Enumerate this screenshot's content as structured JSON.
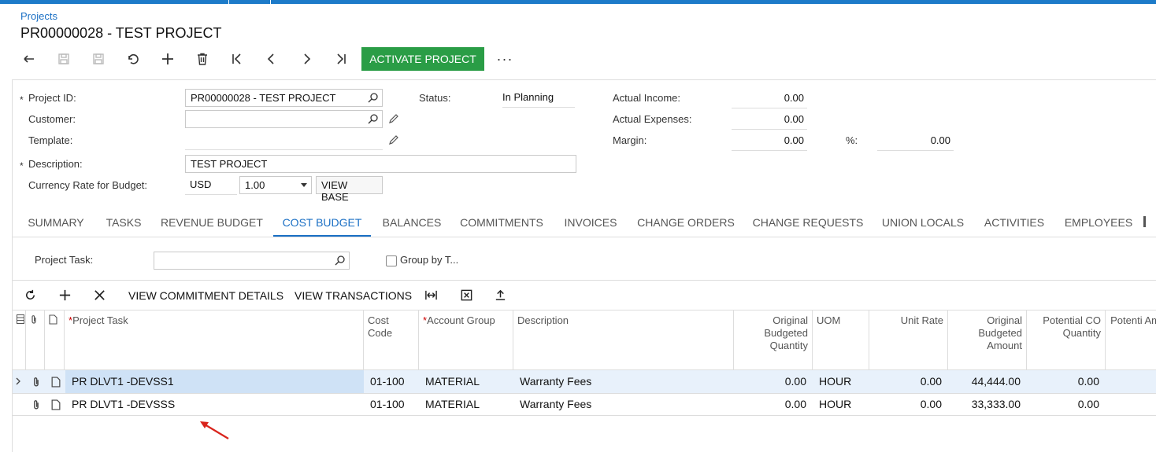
{
  "breadcrumb": "Projects",
  "title": "PR00000028 - TEST PROJECT",
  "toolbar": {
    "icons": [
      "undo-arrow-icon",
      "save-icon",
      "save-close-icon",
      "revert-icon",
      "add-icon",
      "delete-icon",
      "first-icon",
      "prev-icon",
      "next-icon",
      "last-icon"
    ],
    "activate_label": "ACTIVATE PROJECT",
    "more_label": "···"
  },
  "form": {
    "project_id_label": "Project ID:",
    "project_id_value": "PR00000028 - TEST PROJECT",
    "customer_label": "Customer:",
    "customer_value": "",
    "template_label": "Template:",
    "template_value": "",
    "description_label": "Description:",
    "description_value": "TEST PROJECT",
    "currency_label": "Currency Rate for Budget:",
    "currency_value": "USD",
    "rate_value": "1.00",
    "view_base_label": "VIEW BASE",
    "status_label": "Status:",
    "status_value": "In Planning",
    "actual_income_label": "Actual Income:",
    "actual_income_value": "0.00",
    "actual_expenses_label": "Actual Expenses:",
    "actual_expenses_value": "0.00",
    "margin_label": "Margin:",
    "margin_value": "0.00",
    "percent_label": "%:",
    "percent_value": "0.00",
    "required_mark": "*"
  },
  "tabs": [
    "SUMMARY",
    "TASKS",
    "REVENUE BUDGET",
    "COST BUDGET",
    "BALANCES",
    "COMMITMENTS",
    "INVOICES",
    "CHANGE ORDERS",
    "CHANGE REQUESTS",
    "UNION LOCALS",
    "ACTIVITIES",
    "EMPLOYEES"
  ],
  "active_tab": "COST BUDGET",
  "filter": {
    "project_task_label": "Project Task:",
    "project_task_value": "",
    "group_by_label": "Group by T..."
  },
  "grid_toolbar": {
    "view_commitment_label": "VIEW COMMITMENT DETAILS",
    "view_transactions_label": "VIEW TRANSACTIONS"
  },
  "grid": {
    "headers": {
      "project_task": "Project Task",
      "cost_code": "Cost Code",
      "account_group": "Account Group",
      "description": "Description",
      "orig_qty": "Original Budgeted Quantity",
      "uom": "UOM",
      "unit_rate": "Unit Rate",
      "orig_amount": "Original Budgeted Amount",
      "potential_co_qty": "Potential CO Quantity",
      "potential_am": "Potenti Am"
    },
    "rows": [
      {
        "project_task": "PR DLVT1 -DEVSS1",
        "cost_code": "01-100",
        "account_group": "MATERIAL",
        "description": "Warranty Fees",
        "orig_qty": "0.00",
        "uom": "HOUR",
        "unit_rate": "0.00",
        "orig_amount": "44,444.00",
        "potential_co_qty": "0.00"
      },
      {
        "project_task": "PR DLVT1 -DEVSSS",
        "cost_code": "01-100",
        "account_group": "MATERIAL",
        "description": "Warranty Fees",
        "orig_qty": "0.00",
        "uom": "HOUR",
        "unit_rate": "0.00",
        "orig_amount": "33,333.00",
        "potential_co_qty": "0.00"
      }
    ]
  },
  "colors": {
    "accent": "#1a6fc4",
    "activate": "#2a9d46",
    "arrow": "#d9241c",
    "selected_row": "#e8f1fb"
  }
}
